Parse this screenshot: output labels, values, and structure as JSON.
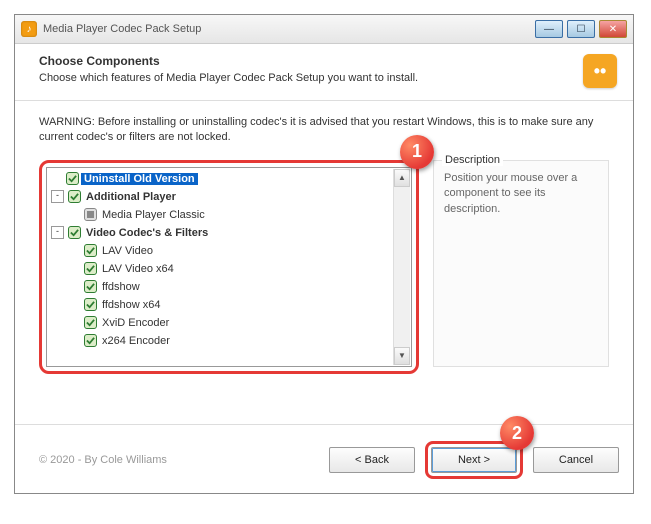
{
  "window": {
    "title": "Media Player Codec Pack Setup"
  },
  "header": {
    "title": "Choose Components",
    "subtitle": "Choose which features of Media Player Codec Pack Setup you want to install."
  },
  "warning": "WARNING: Before installing or uninstalling codec's it is advised that you restart Windows, this is to make sure any current codec's or filters are not locked.",
  "tree": {
    "items": [
      {
        "depth": 0,
        "expander": "",
        "check": "checked",
        "label": "Uninstall Old Version",
        "selected": true,
        "bold": true
      },
      {
        "depth": 0,
        "expander": "-",
        "check": "checked",
        "label": "Additional Player",
        "bold": true
      },
      {
        "depth": 1,
        "expander": "",
        "check": "intermediate",
        "label": "Media Player Classic"
      },
      {
        "depth": 0,
        "expander": "-",
        "check": "checked",
        "label": "Video Codec's & Filters",
        "bold": true
      },
      {
        "depth": 1,
        "expander": "",
        "check": "checked",
        "label": "LAV Video"
      },
      {
        "depth": 1,
        "expander": "",
        "check": "checked",
        "label": "LAV Video x64"
      },
      {
        "depth": 1,
        "expander": "",
        "check": "checked",
        "label": "ffdshow"
      },
      {
        "depth": 1,
        "expander": "",
        "check": "checked",
        "label": "ffdshow x64"
      },
      {
        "depth": 1,
        "expander": "",
        "check": "checked",
        "label": "XviD Encoder"
      },
      {
        "depth": 1,
        "expander": "",
        "check": "checked",
        "label": "x264 Encoder"
      }
    ]
  },
  "description": {
    "title": "Description",
    "body": "Position your mouse over a component to see its description."
  },
  "footer": {
    "copyright": "© 2020 - By Cole Williams",
    "back": "< Back",
    "next": "Next >",
    "cancel": "Cancel"
  },
  "callouts": {
    "one": "1",
    "two": "2"
  }
}
